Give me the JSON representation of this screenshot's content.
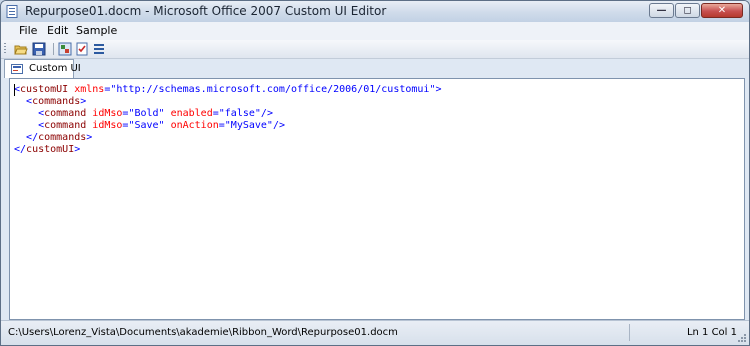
{
  "window": {
    "title": "Repurpose01.docm - Microsoft Office 2007 Custom UI Editor"
  },
  "window_buttons": {
    "minimize": "minimize-icon",
    "maximize": "maximize-icon",
    "close": "close-icon"
  },
  "menu": {
    "file": "File",
    "edit": "Edit",
    "sample": "Sample"
  },
  "toolbar": {
    "icons": [
      "open-icon",
      "save-icon",
      "insert-icons-icon",
      "validate-icon",
      "generate-callbacks-icon"
    ]
  },
  "tab": {
    "label": "Custom UI"
  },
  "editor": {
    "lines": [
      [
        {
          "t": "<",
          "c": "bracket"
        },
        {
          "t": "customUI",
          "c": "tag"
        },
        {
          "t": " xmlns",
          "c": "attr"
        },
        {
          "t": "=",
          "c": "bracket"
        },
        {
          "t": "\"http://schemas.microsoft.com/office/2006/01/customui\"",
          "c": "value"
        },
        {
          "t": ">",
          "c": "bracket"
        }
      ],
      [
        {
          "t": "  ",
          "c": "text"
        },
        {
          "t": "<",
          "c": "bracket"
        },
        {
          "t": "commands",
          "c": "tag"
        },
        {
          "t": ">",
          "c": "bracket"
        }
      ],
      [
        {
          "t": "    ",
          "c": "text"
        },
        {
          "t": "<",
          "c": "bracket"
        },
        {
          "t": "command",
          "c": "tag"
        },
        {
          "t": " idMso",
          "c": "attr"
        },
        {
          "t": "=",
          "c": "bracket"
        },
        {
          "t": "\"Bold\"",
          "c": "value"
        },
        {
          "t": " enabled",
          "c": "attr"
        },
        {
          "t": "=",
          "c": "bracket"
        },
        {
          "t": "\"false\"",
          "c": "value"
        },
        {
          "t": "/>",
          "c": "bracket"
        }
      ],
      [
        {
          "t": "    ",
          "c": "text"
        },
        {
          "t": "<",
          "c": "bracket"
        },
        {
          "t": "command",
          "c": "tag"
        },
        {
          "t": " idMso",
          "c": "attr"
        },
        {
          "t": "=",
          "c": "bracket"
        },
        {
          "t": "\"Save\"",
          "c": "value"
        },
        {
          "t": " onAction",
          "c": "attr"
        },
        {
          "t": "=",
          "c": "bracket"
        },
        {
          "t": "\"MySave\"",
          "c": "value"
        },
        {
          "t": "/>",
          "c": "bracket"
        }
      ],
      [
        {
          "t": "  ",
          "c": "text"
        },
        {
          "t": "</",
          "c": "bracket"
        },
        {
          "t": "commands",
          "c": "tag"
        },
        {
          "t": ">",
          "c": "bracket"
        }
      ],
      [
        {
          "t": "</",
          "c": "bracket"
        },
        {
          "t": "customUI",
          "c": "tag"
        },
        {
          "t": ">",
          "c": "bracket"
        }
      ]
    ]
  },
  "status": {
    "path": "C:\\Users\\Lorenz_Vista\\Documents\\akademie\\Ribbon_Word\\Repurpose01.docm",
    "position": "Ln 1  Col 1"
  },
  "colors": {
    "bracket": "#0000ff",
    "tag": "#8b0000",
    "attr": "#ff0000",
    "value": "#0000ff",
    "text": "#000000"
  }
}
